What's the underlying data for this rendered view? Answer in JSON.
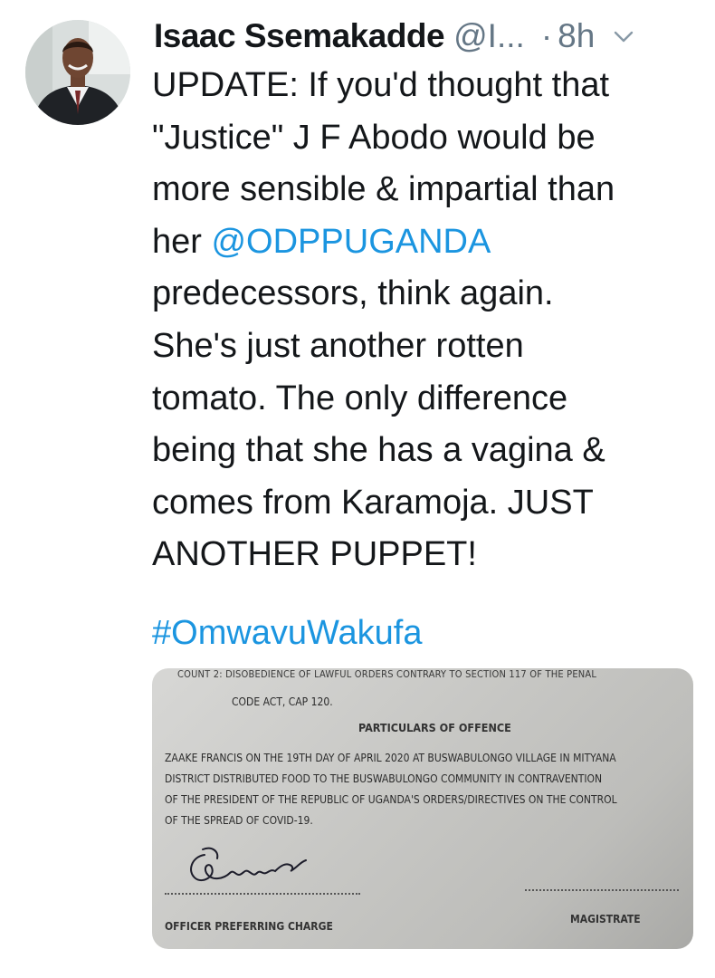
{
  "tweet": {
    "author_name": "Isaac Ssemakadde",
    "handle": "@I...",
    "separator": "·",
    "time": "8h",
    "text_lines": [
      "UPDATE: If you'd thought that",
      "\"Justice\" J F Abodo would be",
      "more sensible & impartial than",
      "predecessors, think again.",
      "She's just another rotten",
      "tomato. The only difference",
      "being that she has a vagina &",
      "comes from Karamoja. JUST",
      "ANOTHER PUPPET!"
    ],
    "line4_prefix": "her ",
    "mention": "@ODPPUGANDA",
    "hashtag": "#OmwavuWakufa",
    "link_color": "#1b95e0",
    "icons": {
      "more": "chevron-down-icon",
      "avatar": "avatar"
    }
  },
  "document": {
    "top_line": "COUNT 2: DISOBEDIENCE OF LAWFUL ORDERS CONTRARY TO SECTION 117 OF THE PENAL",
    "code_line": "CODE ACT, CAP 120.",
    "heading": "PARTICULARS OF OFFENCE",
    "body_lines": [
      "ZAAKE FRANCIS ON THE 19TH DAY OF APRIL 2020 AT BUSWABULONGO VILLAGE IN MITYANA",
      "DISTRICT DISTRIBUTED FOOD TO THE BUSWABULONGO COMMUNITY IN CONTRAVENTION",
      "OF THE PRESIDENT OF THE REPUBLIC OF UGANDA'S ORDERS/DIRECTIVES ON THE CONTROL",
      "OF THE SPREAD OF COVID-19."
    ],
    "officer_label": "OFFICER PREFERRING CHARGE",
    "magistrate_label": "MAGISTRATE"
  }
}
